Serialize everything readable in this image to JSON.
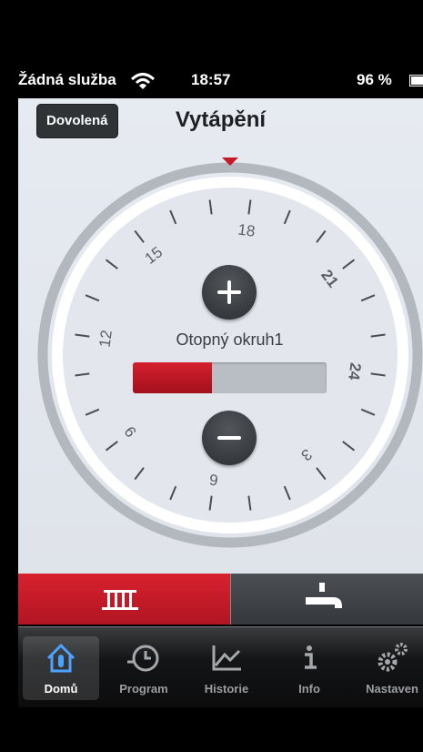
{
  "status_bar": {
    "carrier": "Žádná služba",
    "time": "18:57",
    "battery": "96 %",
    "battery_level": 0.96
  },
  "header": {
    "vacation_button": "Dovolená",
    "title": "Vytápění"
  },
  "dial": {
    "labels": [
      "18",
      "21",
      "24",
      "3",
      "6",
      "9",
      "12",
      "15"
    ],
    "circuit_name": "Otopný okruh1",
    "level_fraction": 0.41
  },
  "mode_bar": {
    "active": "heating",
    "items": [
      {
        "name": "heating",
        "icon": "radiator-icon"
      },
      {
        "name": "hot-water",
        "icon": "faucet-icon"
      }
    ]
  },
  "tabs": [
    {
      "label": "Domů",
      "icon": "home-icon",
      "active": true
    },
    {
      "label": "Program",
      "icon": "clock-icon",
      "active": false
    },
    {
      "label": "Historie",
      "icon": "chart-icon",
      "active": false
    },
    {
      "label": "Info",
      "icon": "info-icon",
      "active": false
    },
    {
      "label": "Nastaven",
      "icon": "gear-icon",
      "active": false
    }
  ],
  "colors": {
    "accent": "#c8192a",
    "dark_button": "#2f3336",
    "background": "#e4e8ee"
  }
}
